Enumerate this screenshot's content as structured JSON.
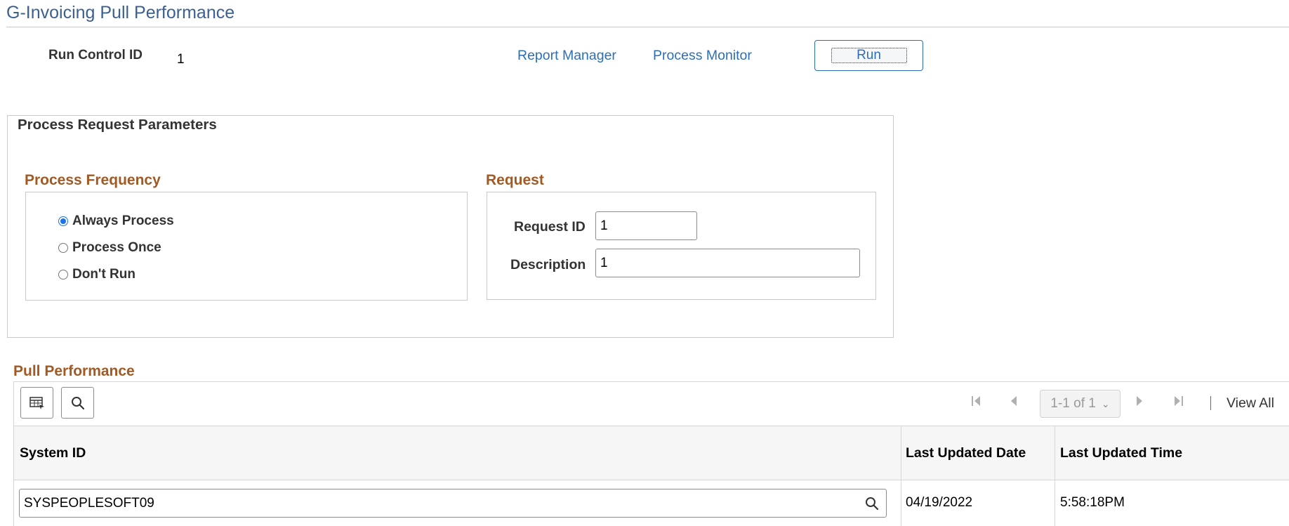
{
  "header": {
    "title": "G-Invoicing Pull Performance",
    "run_control_label": "Run Control ID",
    "run_control_value": "1",
    "report_manager_label": "Report Manager",
    "process_monitor_label": "Process Monitor",
    "run_label": "Run"
  },
  "params": {
    "title": "Process Request Parameters",
    "frequency": {
      "title": "Process Frequency",
      "options": [
        "Always Process",
        "Process Once",
        "Don't Run"
      ],
      "selected": "Always Process"
    },
    "request": {
      "title": "Request",
      "request_id_label": "Request ID",
      "request_id_value": "1",
      "description_label": "Description",
      "description_value": "1"
    }
  },
  "grid": {
    "title": "Pull Performance",
    "pagination": "1-1 of 1",
    "view_all_label": "View All",
    "columns": [
      "System ID",
      "Last Updated Date",
      "Last Updated Time"
    ],
    "rows": [
      {
        "system_id": "SYSPEOPLESOFT09",
        "last_updated_date": "04/19/2022",
        "last_updated_time": "5:58:18PM"
      }
    ]
  },
  "icons": {
    "personalize": "grid-personalize-icon",
    "find": "search-icon",
    "lookup": "search-icon",
    "first": "first-page-icon",
    "previous": "previous-page-icon",
    "next": "next-page-icon",
    "last": "last-page-icon"
  },
  "colors": {
    "title": "#3c6090",
    "link": "#2c6fb6",
    "section": "#a25a24",
    "radio_selected": "#1a73e8"
  }
}
